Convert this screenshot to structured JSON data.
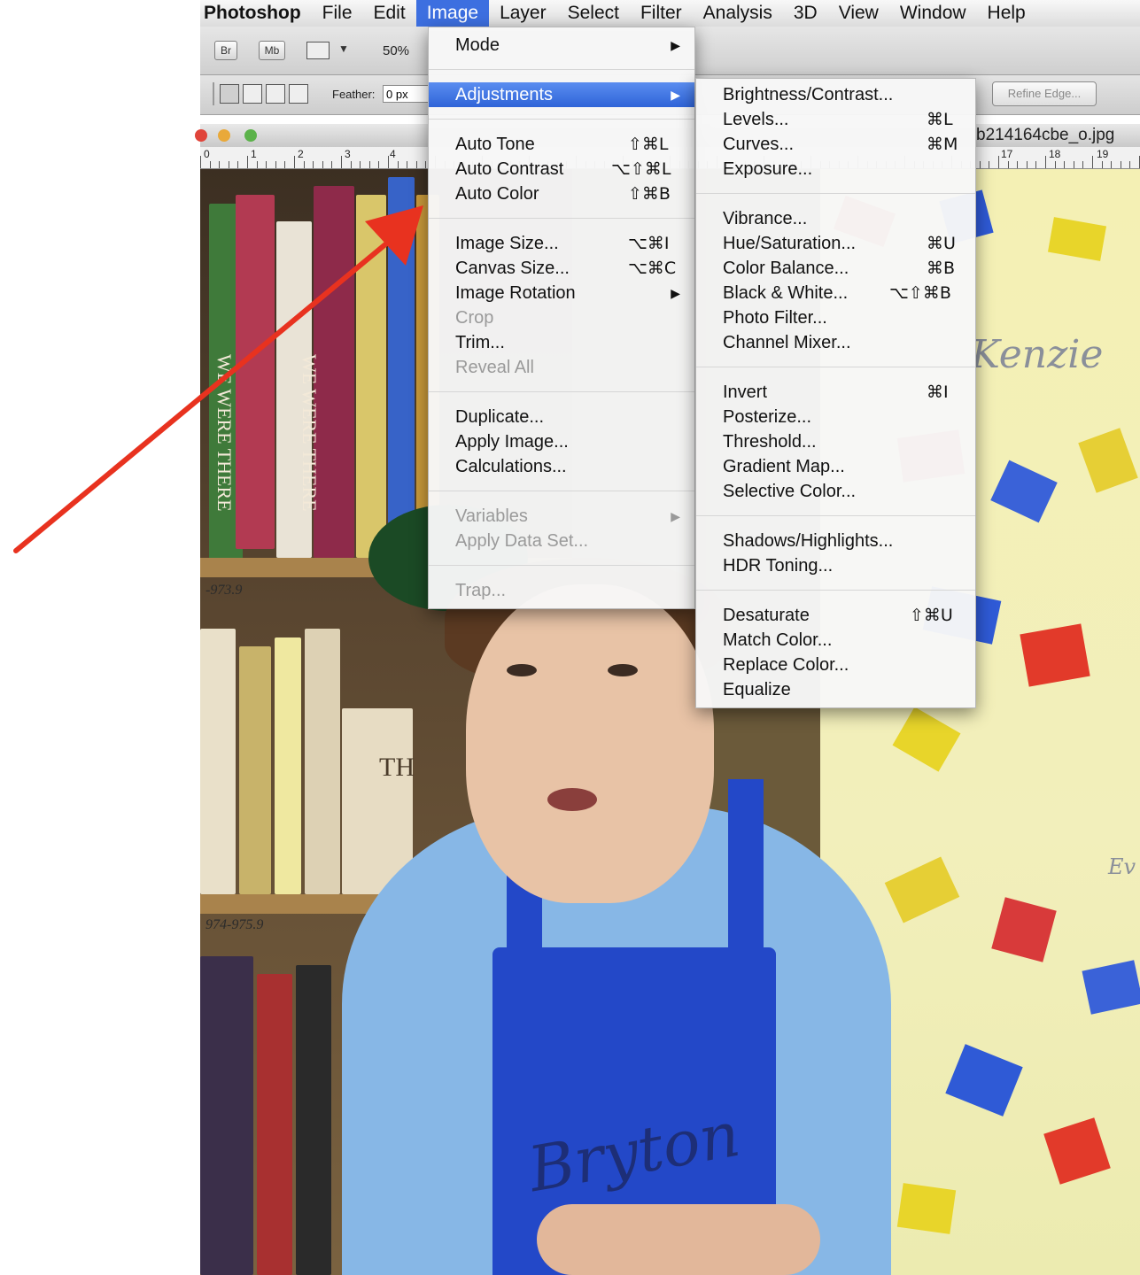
{
  "menubar": {
    "items": [
      "Photoshop",
      "File",
      "Edit",
      "Image",
      "Layer",
      "Select",
      "Filter",
      "Analysis",
      "3D",
      "View",
      "Window",
      "Help"
    ],
    "active": "Image"
  },
  "options_bar": {
    "btn_br": "Br",
    "btn_mb": "Mb",
    "zoom": "50%",
    "feather_label": "Feather:",
    "feather_value": "0 px",
    "refine_edge": "Refine Edge..."
  },
  "document": {
    "title_fragment": "b214164cbe_o.jpg"
  },
  "ruler": {
    "left_labels": [
      "0",
      "1",
      "2",
      "3",
      "4"
    ],
    "right_labels": [
      "17",
      "18",
      "19"
    ]
  },
  "image_menu": {
    "items": [
      {
        "label": "Mode",
        "shortcut": "",
        "submenu": true,
        "disabled": false
      },
      {
        "label": "Adjustments",
        "shortcut": "",
        "submenu": true,
        "disabled": false,
        "highlight": true
      },
      {
        "label": "Auto Tone",
        "shortcut": "⇧⌘L",
        "submenu": false,
        "disabled": false
      },
      {
        "label": "Auto Contrast",
        "shortcut": "⌥⇧⌘L",
        "submenu": false,
        "disabled": false
      },
      {
        "label": "Auto Color",
        "shortcut": "⇧⌘B",
        "submenu": false,
        "disabled": false
      },
      {
        "label": "Image Size...",
        "shortcut": "⌥⌘I",
        "submenu": false,
        "disabled": false
      },
      {
        "label": "Canvas Size...",
        "shortcut": "⌥⌘C",
        "submenu": false,
        "disabled": false
      },
      {
        "label": "Image Rotation",
        "shortcut": "",
        "submenu": true,
        "disabled": false
      },
      {
        "label": "Crop",
        "shortcut": "",
        "submenu": false,
        "disabled": true
      },
      {
        "label": "Trim...",
        "shortcut": "",
        "submenu": false,
        "disabled": false
      },
      {
        "label": "Reveal All",
        "shortcut": "",
        "submenu": false,
        "disabled": true
      },
      {
        "label": "Duplicate...",
        "shortcut": "",
        "submenu": false,
        "disabled": false
      },
      {
        "label": "Apply Image...",
        "shortcut": "",
        "submenu": false,
        "disabled": false
      },
      {
        "label": "Calculations...",
        "shortcut": "",
        "submenu": false,
        "disabled": false
      },
      {
        "label": "Variables",
        "shortcut": "",
        "submenu": true,
        "disabled": true
      },
      {
        "label": "Apply Data Set...",
        "shortcut": "",
        "submenu": false,
        "disabled": true
      },
      {
        "label": "Trap...",
        "shortcut": "",
        "submenu": false,
        "disabled": true
      }
    ]
  },
  "adjustments_menu": {
    "items": [
      {
        "label": "Brightness/Contrast...",
        "shortcut": ""
      },
      {
        "label": "Levels...",
        "shortcut": "⌘L"
      },
      {
        "label": "Curves...",
        "shortcut": "⌘M"
      },
      {
        "label": "Exposure...",
        "shortcut": ""
      },
      {
        "label": "Vibrance...",
        "shortcut": ""
      },
      {
        "label": "Hue/Saturation...",
        "shortcut": "⌘U"
      },
      {
        "label": "Color Balance...",
        "shortcut": "⌘B"
      },
      {
        "label": "Black & White...",
        "shortcut": "⌥⇧⌘B"
      },
      {
        "label": "Photo Filter...",
        "shortcut": ""
      },
      {
        "label": "Channel Mixer...",
        "shortcut": ""
      },
      {
        "label": "Invert",
        "shortcut": "⌘I"
      },
      {
        "label": "Posterize...",
        "shortcut": ""
      },
      {
        "label": "Threshold...",
        "shortcut": ""
      },
      {
        "label": "Gradient Map...",
        "shortcut": ""
      },
      {
        "label": "Selective Color...",
        "shortcut": ""
      },
      {
        "label": "Shadows/Highlights...",
        "shortcut": ""
      },
      {
        "label": "HDR Toning...",
        "shortcut": ""
      },
      {
        "label": "Desaturate",
        "shortcut": "⇧⌘U"
      },
      {
        "label": "Match Color...",
        "shortcut": ""
      },
      {
        "label": "Replace Color...",
        "shortcut": ""
      },
      {
        "label": "Equalize",
        "shortcut": ""
      }
    ]
  },
  "photo": {
    "shelf_label_top": "-973.9",
    "shelf_label_bottom": "974-975.9",
    "book_title_1": "WE WERE THERE",
    "book_title_2": "WE WERE THERE",
    "book_spine_th": "TH",
    "paper_name_1": "Kenzie",
    "paper_name_2": "Ev",
    "apron_name": "Bryton"
  },
  "colors": {
    "menu_highlight": "#3d6fe0",
    "annotation_arrow": "#e8321f",
    "apron": "#2348c8"
  }
}
